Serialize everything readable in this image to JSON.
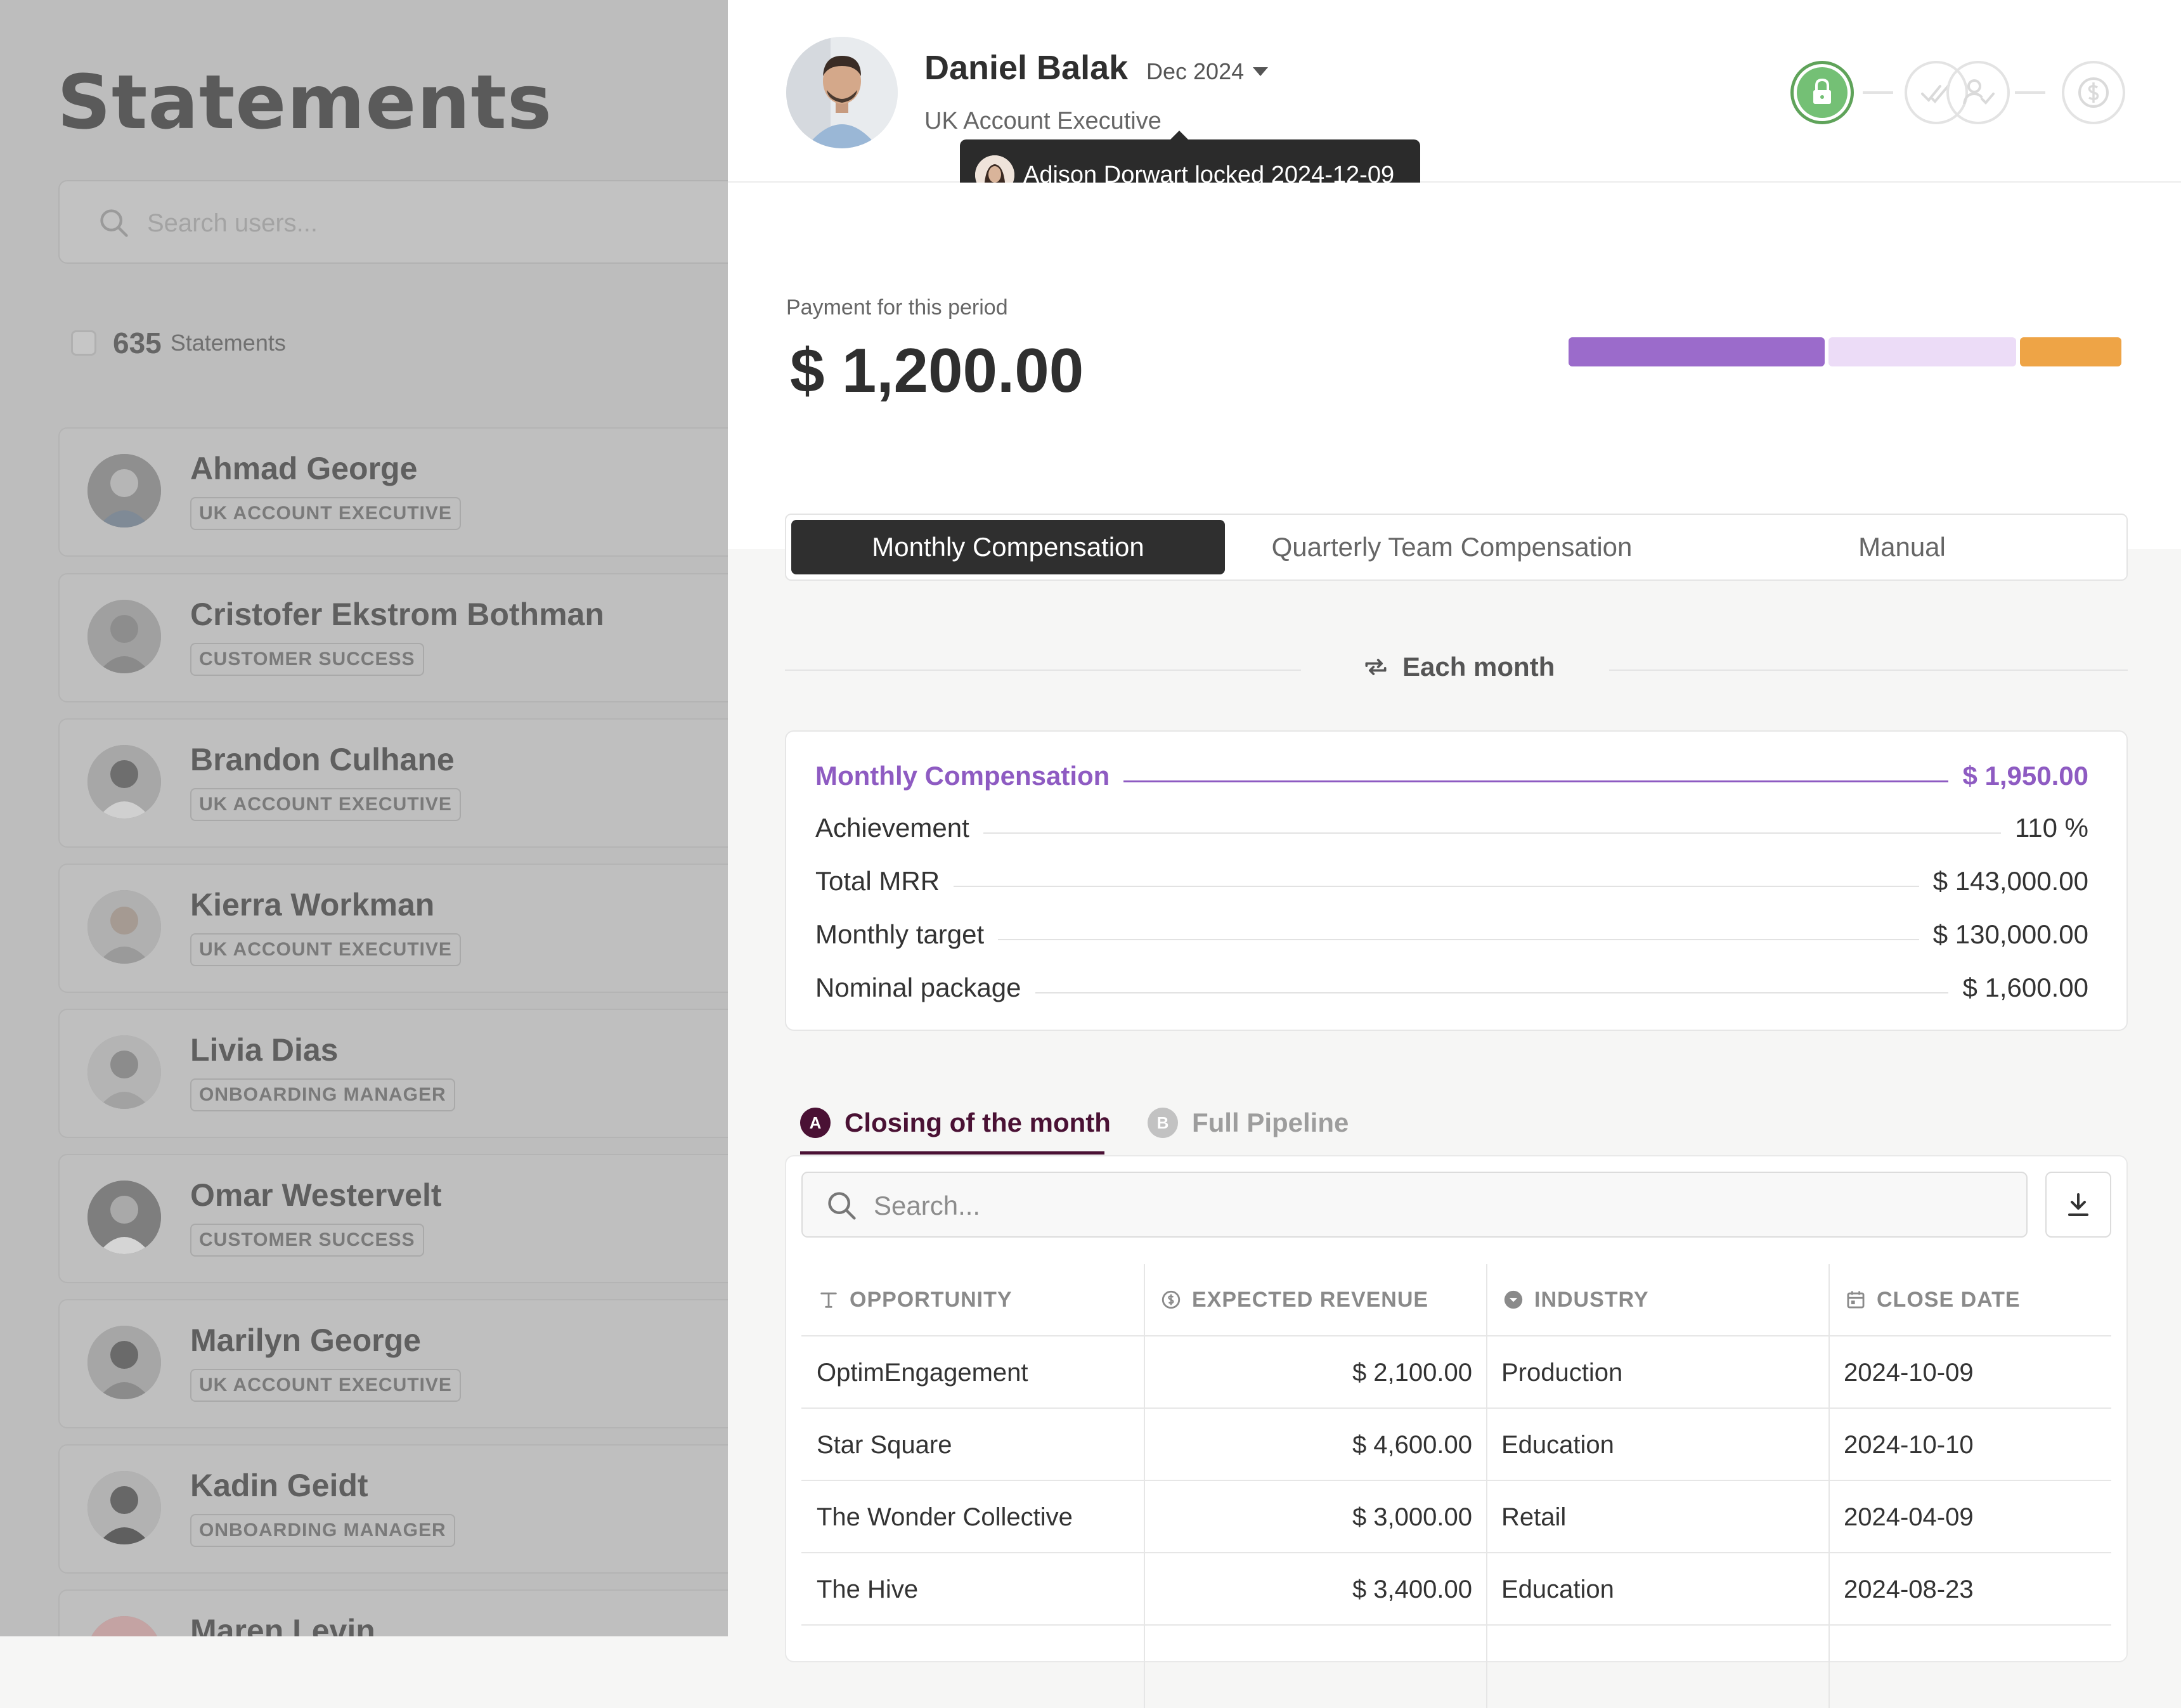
{
  "sidebar": {
    "title": "Statements",
    "search_placeholder": "Search users...",
    "count": "635",
    "count_label": "Statements",
    "users": [
      {
        "name": "Ahmad George",
        "role": "UK ACCOUNT EXECUTIVE"
      },
      {
        "name": "Cristofer Ekstrom Bothman",
        "role": "CUSTOMER SUCCESS"
      },
      {
        "name": "Brandon Culhane",
        "role": "UK ACCOUNT EXECUTIVE"
      },
      {
        "name": "Kierra Workman",
        "role": "UK ACCOUNT EXECUTIVE"
      },
      {
        "name": "Livia Dias",
        "role": "ONBOARDING MANAGER"
      },
      {
        "name": "Omar Westervelt",
        "role": "CUSTOMER SUCCESS"
      },
      {
        "name": "Marilyn George",
        "role": "UK ACCOUNT EXECUTIVE"
      },
      {
        "name": "Kadin Geidt",
        "role": "ONBOARDING MANAGER"
      },
      {
        "name": "Maren Levin",
        "role": ""
      }
    ]
  },
  "profile": {
    "name": "Daniel Balak",
    "role": "UK Account Executive",
    "period": "Dec 2024"
  },
  "workflow": {
    "steps": [
      "lock-icon",
      "double-check-icon",
      "user-check-icon",
      "dollar-icon"
    ],
    "active_color": "#5fa35a",
    "tooltip": "Adison Dorwart locked 2024-12-09"
  },
  "payment": {
    "label": "Payment for this period",
    "amount": "$ 1,200.00",
    "bar_colors": [
      "#9b6bcb",
      "#ecdcf7",
      "#eea446"
    ]
  },
  "tabs": [
    "Monthly Compensation",
    "Quarterly Team Compensation",
    "Manual"
  ],
  "frequency": "Each month",
  "compensation": {
    "title": "Monthly Compensation",
    "total": "$ 1,950.00",
    "accent_color": "#8e5bc2",
    "rows": [
      {
        "label": "Achievement",
        "value": "110 %"
      },
      {
        "label": "Total MRR",
        "value": "$ 143,000.00"
      },
      {
        "label": "Monthly target",
        "value": "$ 130,000.00"
      },
      {
        "label": "Nominal package",
        "value": "$ 1,600.00"
      }
    ]
  },
  "subtabs": [
    {
      "badge": "A",
      "label": "Closing of the month"
    },
    {
      "badge": "B",
      "label": "Full Pipeline"
    }
  ],
  "table": {
    "search_placeholder": "Search...",
    "columns": [
      "OPPORTUNITY",
      "EXPECTED REVENUE",
      "INDUSTRY",
      "CLOSE DATE"
    ],
    "rows": [
      [
        "OptimEngagement",
        "$ 2,100.00",
        "Production",
        "2024-10-09"
      ],
      [
        "Star Square",
        "$ 4,600.00",
        "Education",
        "2024-10-10"
      ],
      [
        "The Wonder Collective",
        "$ 3,000.00",
        "Retail",
        "2024-04-09"
      ],
      [
        "The Hive",
        "$ 3,400.00",
        "Education",
        "2024-08-23"
      ]
    ]
  }
}
